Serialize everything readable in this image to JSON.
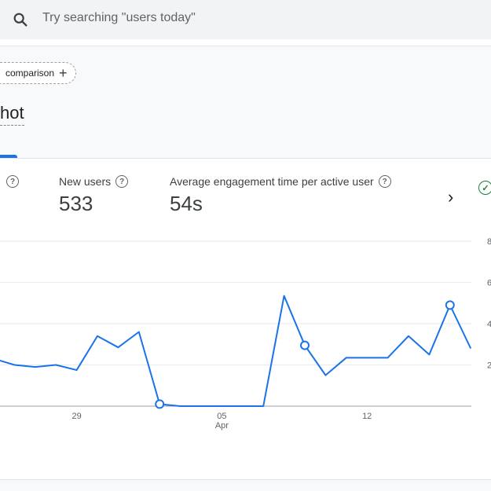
{
  "search": {
    "placeholder": "Try searching \"users today\""
  },
  "comparison_chip": {
    "label": "comparison"
  },
  "page": {
    "title": "hot"
  },
  "metrics": [
    {
      "label": "New users",
      "value": "533"
    },
    {
      "label": "Average engagement time per active user",
      "value": "54s"
    }
  ],
  "colors": {
    "accent": "#1a73e8",
    "success": "#188038"
  },
  "chart_data": {
    "type": "line",
    "x_ticks": [
      {
        "label": "29",
        "sub": ""
      },
      {
        "label": "05",
        "sub": "Apr"
      },
      {
        "label": "12",
        "sub": ""
      }
    ],
    "y_ticks": [
      "2",
      "4",
      "6",
      "8"
    ],
    "ylim": [
      0,
      8
    ],
    "series": [
      {
        "values": [
          2.3,
          2.0,
          1.9,
          2.0,
          1.75,
          3.4,
          2.85,
          3.6,
          0.1,
          0.0,
          0.0,
          0.0,
          0.0,
          0.0,
          5.35,
          2.95,
          1.5,
          2.35,
          2.35,
          2.35,
          3.4,
          2.5,
          4.9,
          2.8
        ],
        "highlighted": [
          8,
          15,
          22
        ]
      }
    ],
    "grid": true
  }
}
